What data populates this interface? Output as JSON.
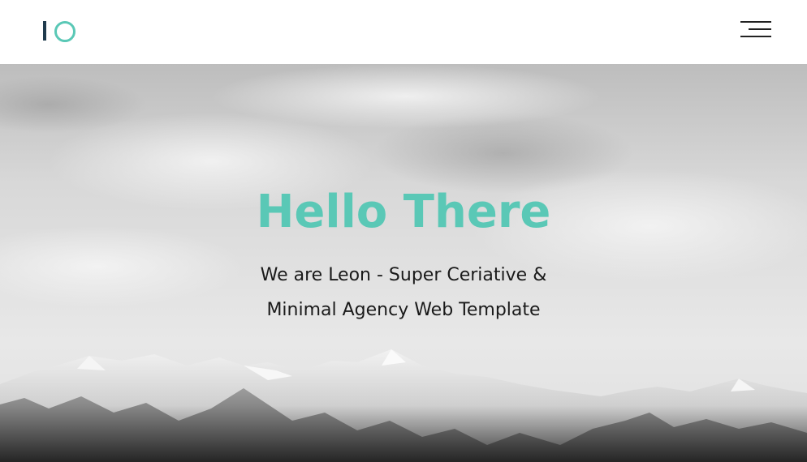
{
  "header": {
    "logo_icon": "io-logo-icon",
    "menu_icon": "hamburger-menu-icon"
  },
  "hero": {
    "title": "Hello There",
    "subtitle_line1": "We are Leon - Super Ceriative &",
    "subtitle_line2": "Minimal Agency Web Template",
    "background": "snowy-mountains-image"
  },
  "colors": {
    "accent": "#5ac8b6",
    "logo_dark": "#1f3b4d",
    "text": "#1a1a1a"
  }
}
